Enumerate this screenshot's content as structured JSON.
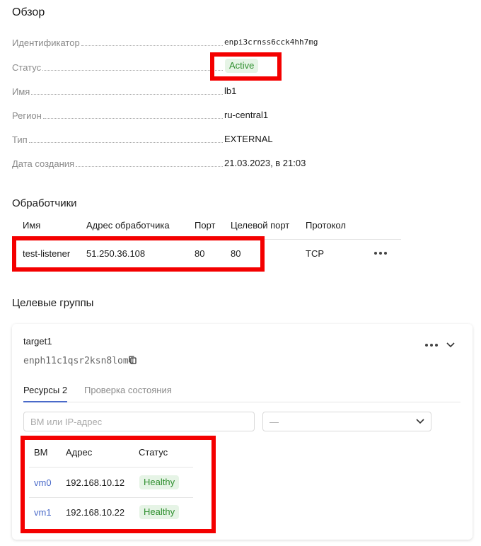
{
  "overview": {
    "title": "Обзор",
    "rows": [
      {
        "label": "Идентификатор",
        "value": "enpi3crnss6cck4hh7mg"
      },
      {
        "label": "Статус",
        "value": "Active"
      },
      {
        "label": "Имя",
        "value": "lb1"
      },
      {
        "label": "Регион",
        "value": "ru-central1"
      },
      {
        "label": "Тип",
        "value": "EXTERNAL"
      },
      {
        "label": "Дата создания",
        "value": "21.03.2023, в 21:03"
      }
    ]
  },
  "listeners": {
    "title": "Обработчики",
    "columns": [
      "Имя",
      "Адрес обработчика",
      "Порт",
      "Целевой порт",
      "Протокол"
    ],
    "rows": [
      {
        "name": "test-listener",
        "address": "51.250.36.108",
        "port": "80",
        "target_port": "80",
        "protocol": "TCP"
      }
    ]
  },
  "target_groups": {
    "title": "Целевые группы",
    "group": {
      "name": "target1",
      "id": "enph11c1qsr2ksn8lomu",
      "tabs": [
        {
          "label": "Ресурсы 2"
        },
        {
          "label": "Проверка состояния"
        }
      ],
      "filter_placeholder": "ВМ или IP-адрес",
      "select_value": "—",
      "columns": [
        "ВМ",
        "Адрес",
        "Статус"
      ],
      "rows": [
        {
          "vm": "vm0",
          "address": "192.168.10.12",
          "status": "Healthy"
        },
        {
          "vm": "vm1",
          "address": "192.168.10.22",
          "status": "Healthy"
        }
      ]
    }
  },
  "colors": {
    "highlight": "#f40000",
    "healthy_bg": "#e6f4e6",
    "healthy_text": "#2f8f2f",
    "link": "#4a6ac9"
  }
}
